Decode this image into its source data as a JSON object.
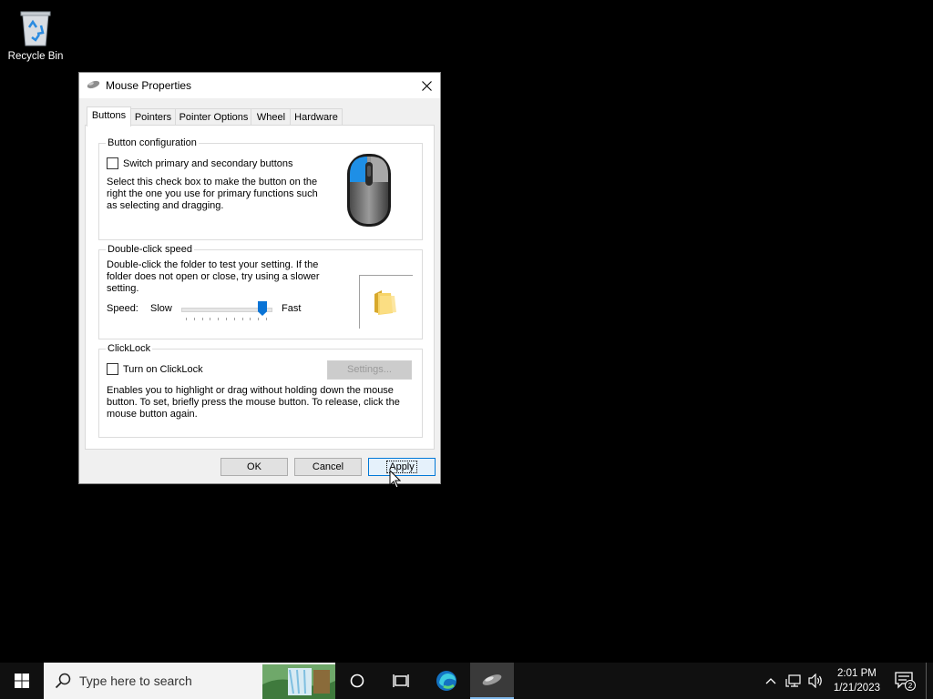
{
  "desktop": {
    "recycle_bin_label": "Recycle Bin"
  },
  "dialog": {
    "title": "Mouse Properties",
    "tabs": [
      {
        "label": "Buttons",
        "active": true
      },
      {
        "label": "Pointers",
        "active": false
      },
      {
        "label": "Pointer Options",
        "active": false
      },
      {
        "label": "Wheel",
        "active": false
      },
      {
        "label": "Hardware",
        "active": false
      }
    ],
    "button_config": {
      "legend": "Button configuration",
      "checkbox_label": "Switch primary and secondary buttons",
      "checked": false,
      "description": "Select this check box to make the button on the right the one you use for primary functions such as selecting and dragging."
    },
    "double_click": {
      "legend": "Double-click speed",
      "description": "Double-click the folder to test your setting. If the folder does not open or close, try using a slower setting.",
      "speed_label": "Speed:",
      "slow_label": "Slow",
      "fast_label": "Fast",
      "speed_value_fraction": 0.95
    },
    "clicklock": {
      "legend": "ClickLock",
      "checkbox_label": "Turn on ClickLock",
      "checked": false,
      "settings_label": "Settings...",
      "description": "Enables you to highlight or drag without holding down the mouse button. To set, briefly press the mouse button. To release, click the mouse button again."
    },
    "buttons": {
      "ok": "OK",
      "cancel": "Cancel",
      "apply": "Apply"
    }
  },
  "taskbar": {
    "search_placeholder": "Type here to search",
    "time": "2:01 PM",
    "date": "1/21/2023",
    "notification_count": "2"
  },
  "colors": {
    "accent": "#0078d7",
    "slider_thumb": "#0a74d6"
  }
}
